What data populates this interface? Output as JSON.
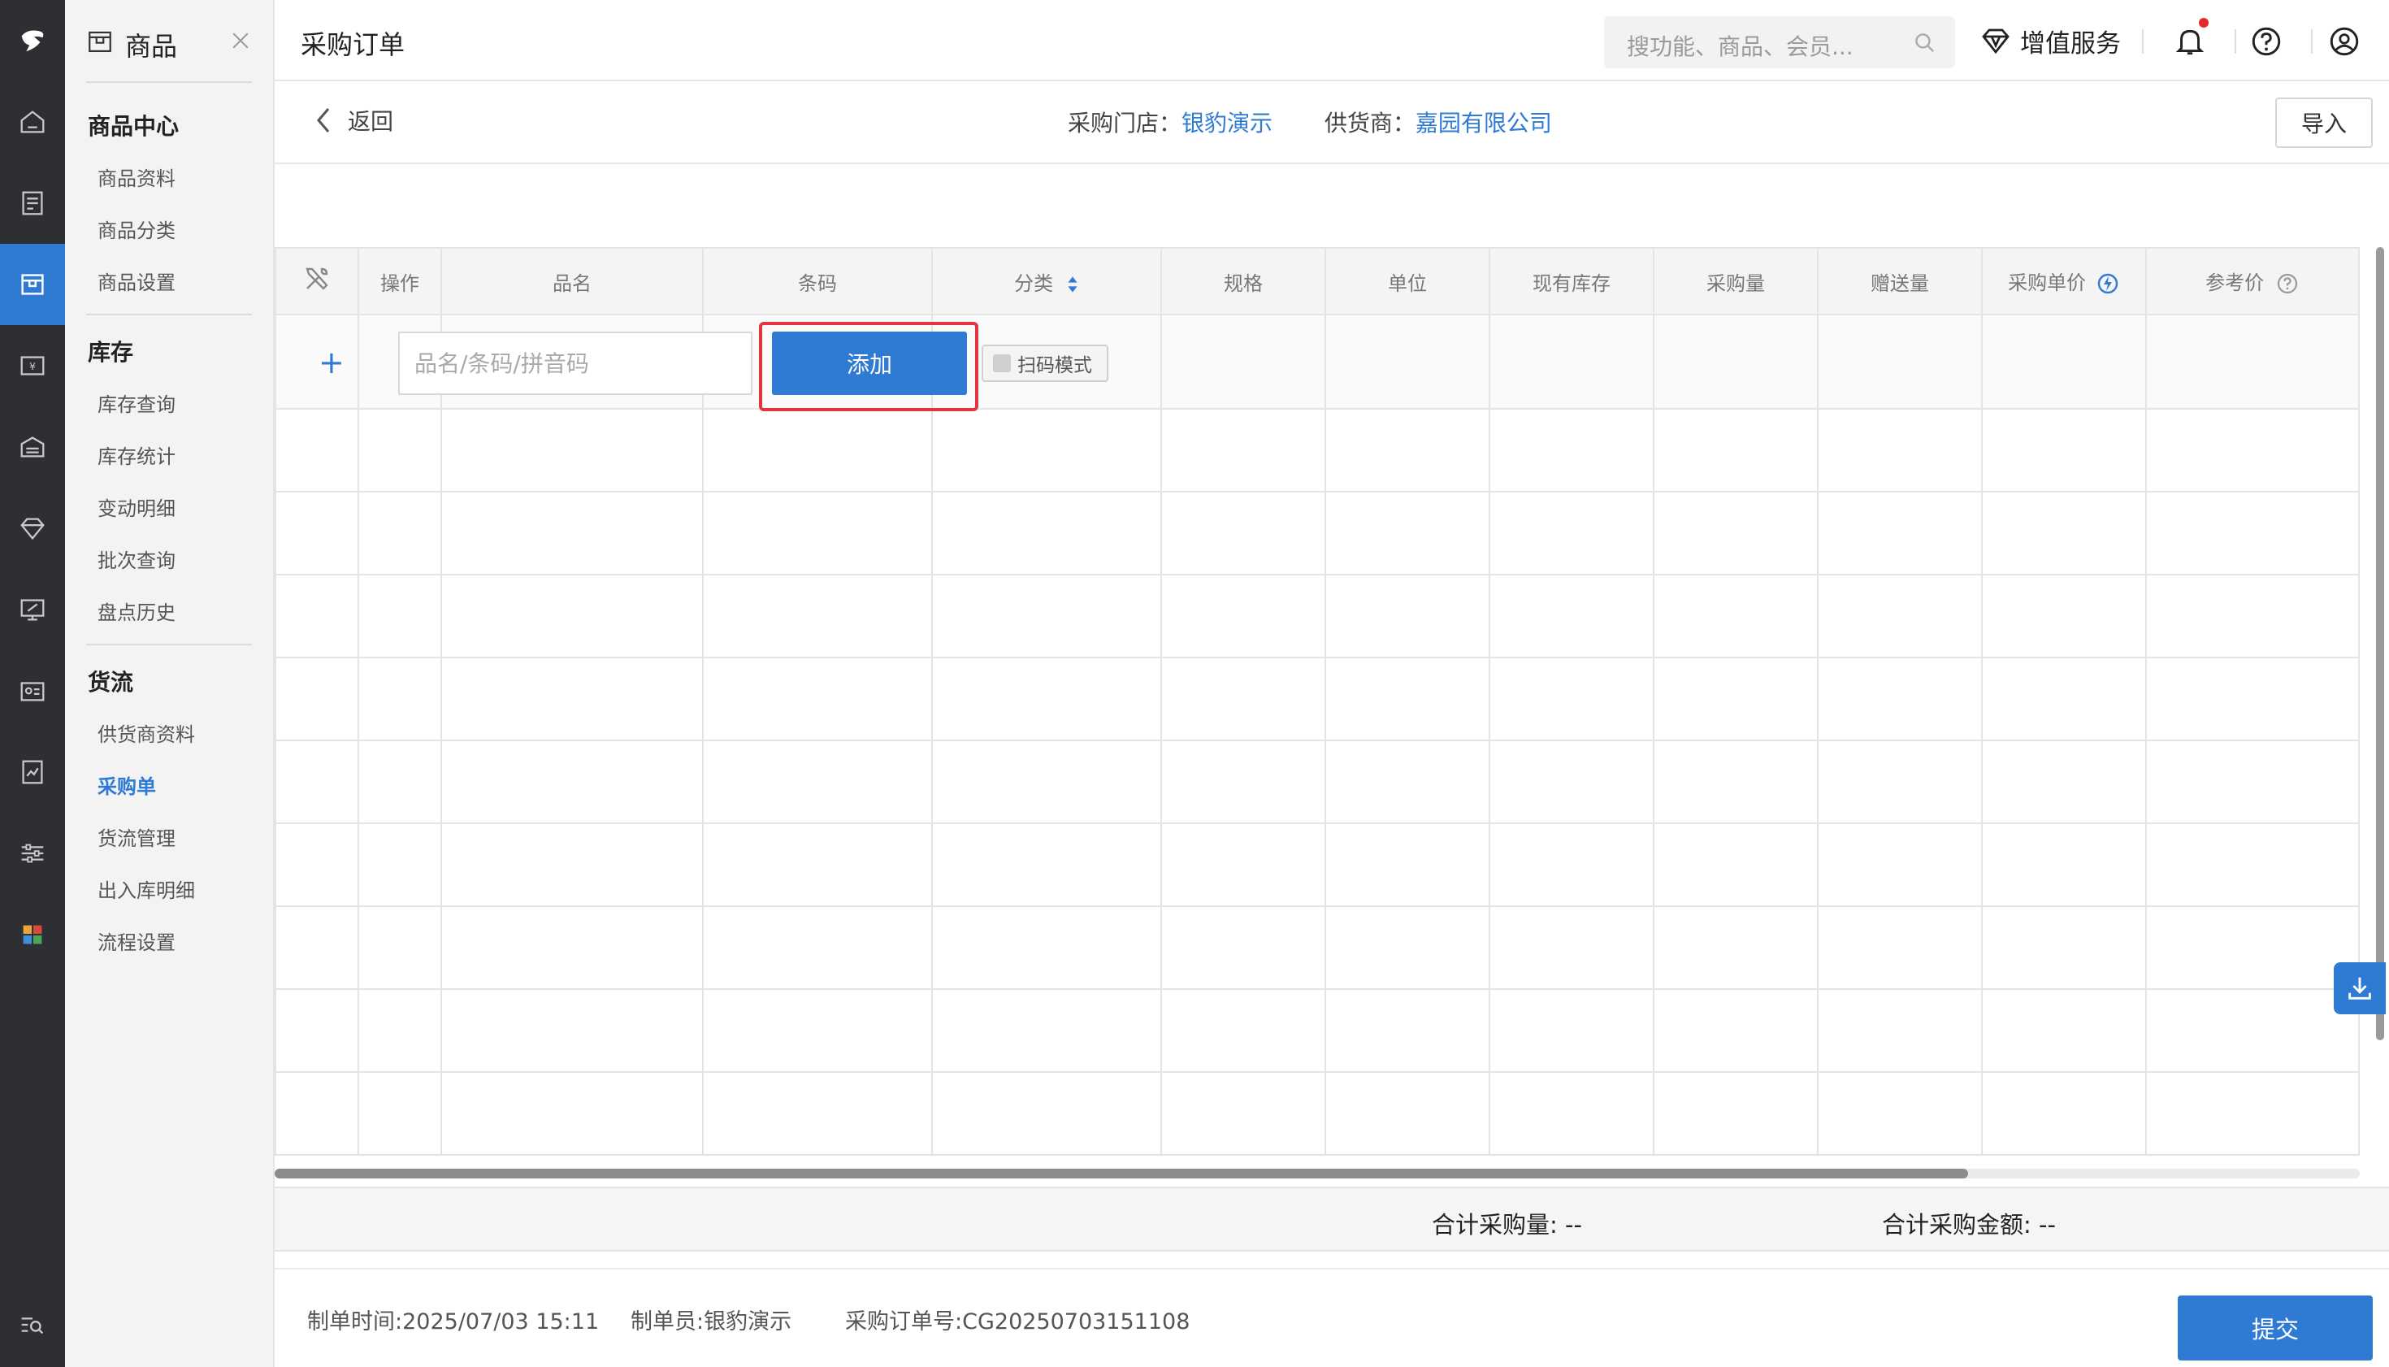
{
  "colors": {
    "rail_bg": "#2d2f33",
    "accent": "#2f7bd4",
    "nav_bg": "#f3f3f4",
    "highlight_border": "#e3343f",
    "notification_dot": "#e5282b"
  },
  "rail": {
    "icons": [
      "home-icon",
      "product-doc-icon",
      "goods-box-icon",
      "cashier-icon",
      "warehouse-icon",
      "diamond-icon",
      "monitor-icon",
      "member-card-icon",
      "report-icon",
      "sliders-icon",
      "apps-icon",
      "search-list-icon"
    ],
    "active_index": 2
  },
  "nav": {
    "title": "商品",
    "groups": [
      {
        "label": "商品中心",
        "items": [
          "商品资料",
          "商品分类",
          "商品设置"
        ]
      },
      {
        "label": "库存",
        "items": [
          "库存查询",
          "库存统计",
          "变动明细",
          "批次查询",
          "盘点历史"
        ]
      },
      {
        "label": "货流",
        "items": [
          "供货商资料",
          "采购单",
          "货流管理",
          "出入库明细",
          "流程设置"
        ]
      }
    ],
    "active_item": "采购单"
  },
  "header": {
    "page_title": "采购订单",
    "search_placeholder": "搜功能、商品、会员...",
    "value_added": "增值服务"
  },
  "subheader": {
    "back_label": "返回",
    "store_label": "采购门店：",
    "store_value": "银豹演示",
    "supplier_label": "供货商：",
    "supplier_value": "嘉园有限公司",
    "import_label": "导入"
  },
  "table": {
    "columns": [
      "",
      "操作",
      "品名",
      "条码",
      "分类",
      "规格",
      "单位",
      "现有库存",
      "采购量",
      "赠送量",
      "采购单价",
      "参考价"
    ],
    "entry_placeholder": "品名/条码/拼音码",
    "add_label": "添加",
    "scan_label": "扫码模式",
    "empty_rows": 9
  },
  "totals": {
    "qty_label": "合计采购量:",
    "qty_value": "--",
    "amount_label": "合计采购金额:",
    "amount_value": "--"
  },
  "footer": {
    "created_time_label": "制单时间:",
    "created_time": "2025/07/03 15:11",
    "creator_label": "制单员:",
    "creator": "银豹演示",
    "order_no_label": "采购订单号:",
    "order_no": "CG20250703151108",
    "submit_label": "提交"
  }
}
